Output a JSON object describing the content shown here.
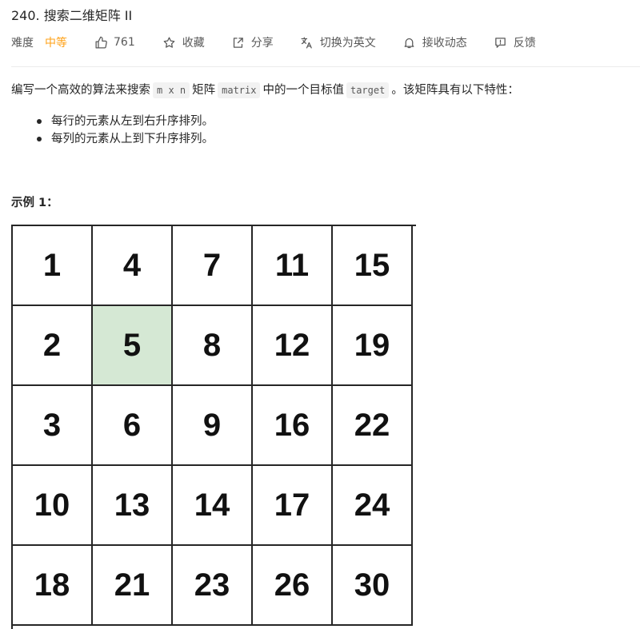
{
  "problem": {
    "title": "240. 搜索二维矩阵 II"
  },
  "meta": {
    "difficulty_label": "难度",
    "difficulty_value": "中等",
    "difficulty_color": "#ffa116",
    "likes": "761",
    "favorite_label": "收藏",
    "share_label": "分享",
    "switch_lang_label": "切换为英文",
    "notify_label": "接收动态",
    "feedback_label": "反馈"
  },
  "description": {
    "part1": "编写一个高效的算法来搜索",
    "code1": "m x n",
    "part2": "矩阵",
    "code2": "matrix",
    "part3": "中的一个目标值",
    "code3": "target",
    "part4": "。该矩阵具有以下特性：",
    "bullets": [
      "每行的元素从左到右升序排列。",
      "每列的元素从上到下升序排列。"
    ]
  },
  "example": {
    "title": "示例 1：",
    "highlight_color": "#d5e8d4",
    "highlight_value": "5",
    "matrix": [
      [
        "1",
        "4",
        "7",
        "11",
        "15"
      ],
      [
        "2",
        "5",
        "8",
        "12",
        "19"
      ],
      [
        "3",
        "6",
        "9",
        "16",
        "22"
      ],
      [
        "10",
        "13",
        "14",
        "17",
        "24"
      ],
      [
        "18",
        "21",
        "23",
        "26",
        "30"
      ]
    ]
  },
  "icons": [
    "thumbs-up-icon",
    "star-icon",
    "share-icon",
    "translate-icon",
    "bell-icon",
    "feedback-icon"
  ]
}
